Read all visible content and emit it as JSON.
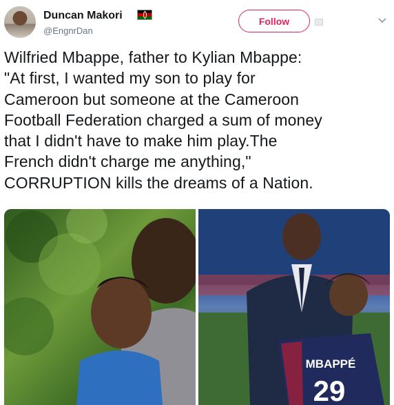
{
  "user": {
    "display_name": "Duncan Makori",
    "handle": "@EngnrDan",
    "flag_icon": "kenya-flag-icon"
  },
  "actions": {
    "follow_label": "Follow",
    "caret_icon": "chevron-down-icon"
  },
  "tweet": {
    "text": "Wilfried Mbappe, father to Kylian Mbappe:\n\"At first, I wanted my son to play for\nCameroon but someone at the Cameroon\nFootball Federation charged a sum of money\nthat I didn't have to make him play.The\nFrench didn't charge me anything,\"\nCORRUPTION kills the dreams of a Nation."
  },
  "media": {
    "right_jersey_name": "MBAPPÉ",
    "right_jersey_number": "29"
  },
  "colors": {
    "follow_accent": "#e0245e",
    "secondary_text": "#657786"
  }
}
